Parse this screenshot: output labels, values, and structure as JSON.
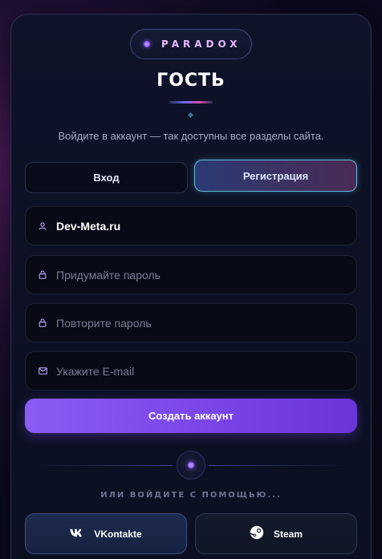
{
  "brand": {
    "name": "PARADOX"
  },
  "header": {
    "title": "ГОСТЬ",
    "subtitle": "Войдите в аккаунт — так доступны все разделы сайта."
  },
  "tabs": {
    "login": "Вход",
    "register": "Регистрация",
    "active": "register"
  },
  "form": {
    "username": {
      "value": "Dev-Meta.ru",
      "icon": "user-icon"
    },
    "password": {
      "placeholder": "Придумайте пароль",
      "icon": "lock-icon"
    },
    "password_repeat": {
      "placeholder": "Повторите пароль",
      "icon": "lock-icon"
    },
    "email": {
      "placeholder": "Укажите E-mail",
      "icon": "mail-icon"
    },
    "submit_label": "Создать аккаунт"
  },
  "divider": {
    "text": "ИЛИ ВОЙДИТЕ С ПОМОЩЬЮ..."
  },
  "social": [
    {
      "label": "VKontakte",
      "icon": "vk-icon"
    },
    {
      "label": "Steam",
      "icon": "steam-icon"
    }
  ],
  "colors": {
    "accent_purple": "#7b47ea",
    "accent_cyan": "#5fb9d6",
    "background": "#0c0f22"
  }
}
